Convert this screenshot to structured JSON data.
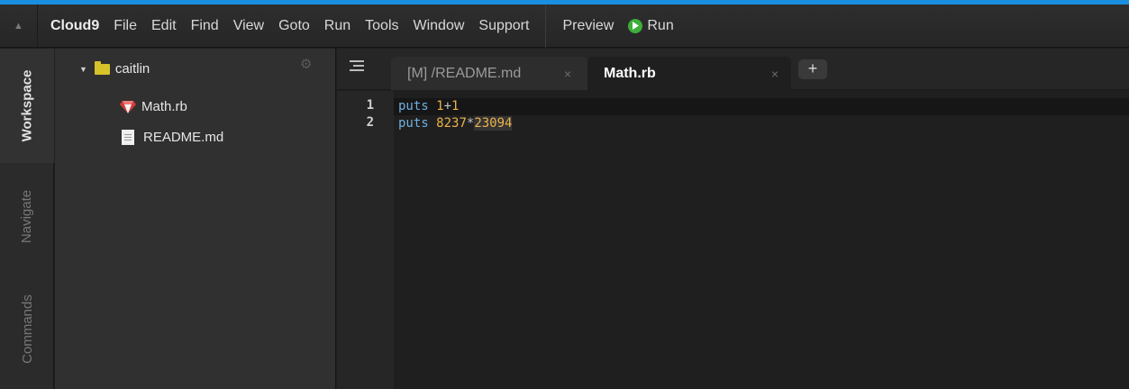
{
  "menubar": {
    "brand": "Cloud9",
    "items": [
      "File",
      "Edit",
      "Find",
      "View",
      "Goto",
      "Run",
      "Tools",
      "Window",
      "Support"
    ],
    "preview_label": "Preview",
    "run_label": "Run",
    "run_icon": "play-circle-icon",
    "run_color": "#3dae3a"
  },
  "sidebar": {
    "tabs": [
      "Workspace",
      "Navigate",
      "Commands"
    ],
    "active_tab": "Workspace"
  },
  "tree": {
    "root": "caitlin",
    "files": [
      {
        "name": "Math.rb",
        "icon": "ruby-file-icon"
      },
      {
        "name": "README.md",
        "icon": "text-file-icon"
      }
    ]
  },
  "editor": {
    "tabs": [
      {
        "label": "[M] /README.md",
        "active": false
      },
      {
        "label": "Math.rb",
        "active": true
      }
    ],
    "close_glyph": "×",
    "add_tab": "+",
    "lines": [
      {
        "num": "1",
        "kw": "puts",
        "a": "1",
        "op": "+",
        "b": "1"
      },
      {
        "num": "2",
        "kw": "puts",
        "a": "8237",
        "op": "*",
        "b": "23094"
      }
    ]
  },
  "colors": {
    "accent_strip": "#1a8fe0",
    "keyword": "#6fb0e0",
    "number": "#ecb34b",
    "folder": "#d6c22a"
  }
}
